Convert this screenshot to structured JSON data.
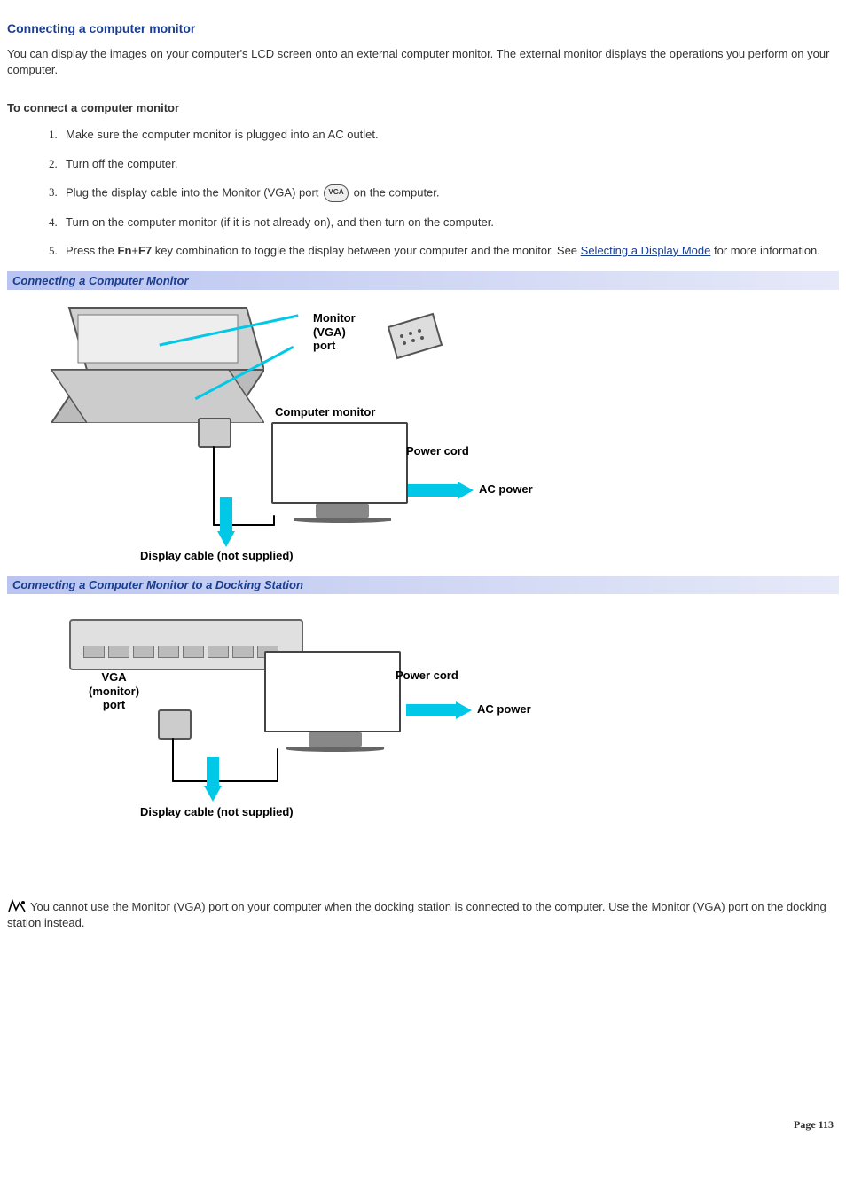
{
  "title": "Connecting a computer monitor",
  "intro": "You can display the images on your computer's LCD screen onto an external computer monitor. The external monitor displays the operations you perform on your computer.",
  "subhead": "To connect a computer monitor",
  "steps": {
    "s1": "Make sure the computer monitor is plugged into an AC outlet.",
    "s2": "Turn off the computer.",
    "s3a": "Plug the display cable into the Monitor (VGA) port ",
    "s3_icon": "VGA",
    "s3b": "on the computer.",
    "s4": "Turn on the computer monitor (if it is not already on), and then turn on the computer.",
    "s5a": "Press the ",
    "s5_fn": "Fn",
    "s5_plus": "+",
    "s5_f7": "F7",
    "s5b": " key combination to toggle the display between your computer and the monitor. See ",
    "s5_link": "Selecting a Display Mode",
    "s5c": " for more information."
  },
  "fig1": {
    "caption": "Connecting a Computer Monitor",
    "labels": {
      "vga_port": "Monitor\n(VGA)\nport",
      "comp_monitor": "Computer monitor",
      "power_cord": "Power cord",
      "ac_power": "AC power",
      "display_cable": "Display cable (not supplied)"
    }
  },
  "fig2": {
    "caption": "Connecting a Computer Monitor to a Docking Station",
    "labels": {
      "vga_port": "VGA\n(monitor)\nport",
      "power_cord": "Power cord",
      "ac_power": "AC power",
      "display_cable": "Display cable (not supplied)"
    }
  },
  "note": "You cannot use the Monitor (VGA) port on your computer when the docking station is connected to the computer. Use the Monitor (VGA) port on the docking station instead.",
  "footer": "Page 113"
}
